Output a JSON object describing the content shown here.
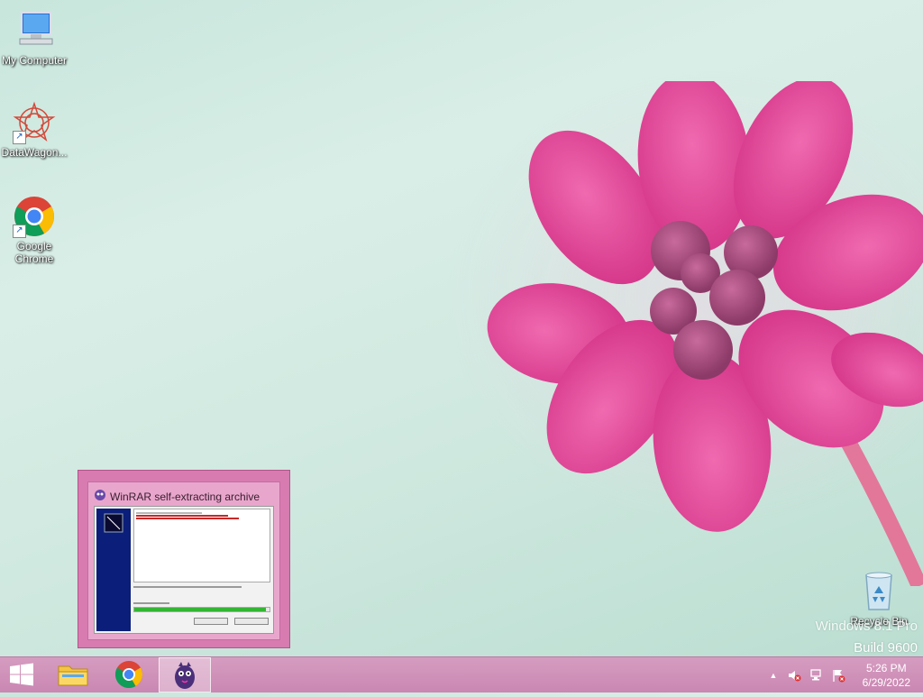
{
  "desktop": {
    "icons": [
      {
        "label": "My Computer",
        "icon": "computer-icon"
      },
      {
        "label": "DataWagon...",
        "icon": "datawagon-icon"
      },
      {
        "label": "Google Chrome",
        "icon": "chrome-icon"
      },
      {
        "label": "Recycle Bin",
        "icon": "recycle-bin-icon"
      }
    ],
    "watermark": {
      "line1": "Windows 8.1 Pro",
      "line2": "Build 9600"
    }
  },
  "thumbnail": {
    "title": "WinRAR self-extracting archive",
    "icon": "winrar-icon",
    "progress": 0.97
  },
  "taskbar": {
    "items": [
      {
        "name": "start",
        "icon": "windows-logo-icon"
      },
      {
        "name": "file-explorer",
        "icon": "folder-icon"
      },
      {
        "name": "chrome",
        "icon": "chrome-icon"
      },
      {
        "name": "winrar",
        "icon": "winrar-icon",
        "active": true
      }
    ],
    "tray": {
      "icons": [
        "show-hidden-icons-chevron-icon",
        "speaker-muted-icon",
        "network-icon",
        "action-center-flag-icon"
      ]
    },
    "clock": {
      "time": "5:26 PM",
      "date": "6/29/2022"
    }
  },
  "colors": {
    "taskbar": "#d08fb8",
    "accent": "#e2519a",
    "progress": "#35b535"
  }
}
